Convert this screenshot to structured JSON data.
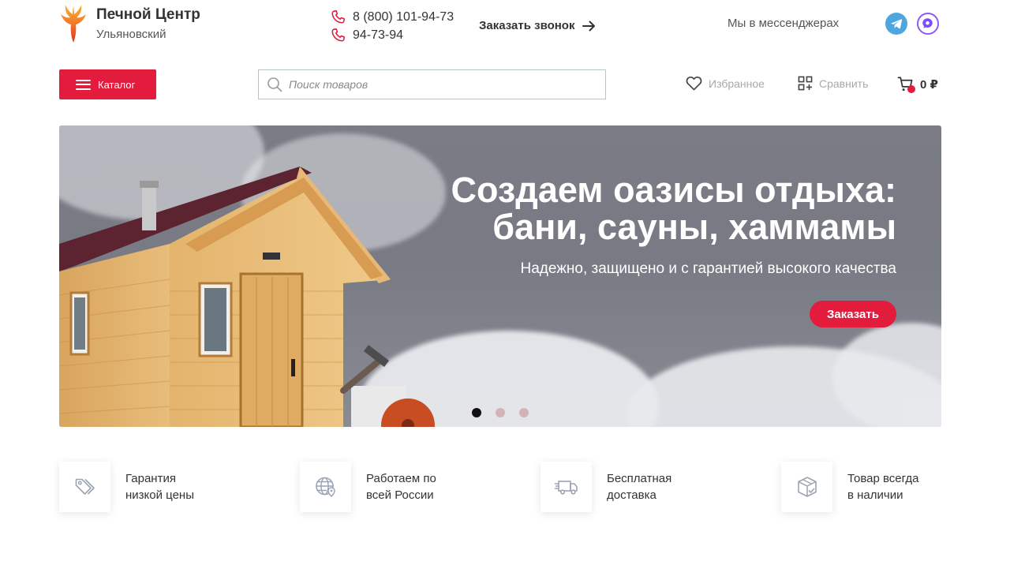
{
  "header": {
    "brand_name": "Печной Центр",
    "brand_sub": "Ульяновский",
    "phones": [
      "8 (800) 101-94-73",
      "94-73-94"
    ],
    "callback_label": "Заказать звонок",
    "messengers_label": "Мы в мессенджерах",
    "messenger_icons": [
      "telegram-icon",
      "max-messenger-icon"
    ]
  },
  "toolbar": {
    "catalog_label": "Каталог",
    "search_placeholder": "Поиск товаров",
    "search_value": "",
    "favorites_label": "Избранное",
    "compare_label": "Сравнить",
    "cart_total": "0 ₽"
  },
  "banner": {
    "title_line1": "Создаем оазисы отдыха:",
    "title_line2": "бани, сауны, хаммамы",
    "subtitle": "Надежно, защищено и с гарантией высокого качества",
    "order_label": "Заказать",
    "slides_count": 3,
    "active_slide": 1
  },
  "features": [
    {
      "line1": "Гарантия",
      "line2": "низкой цены",
      "icon": "price-tag-icon"
    },
    {
      "line1": "Работаем по",
      "line2": "всей России",
      "icon": "globe-location-icon"
    },
    {
      "line1": "Бесплатная",
      "line2": "доставка",
      "icon": "delivery-truck-icon"
    },
    {
      "line1": "Товар всегда",
      "line2": "в наличии",
      "icon": "box-check-icon"
    }
  ],
  "colors": {
    "accent": "#e31b3d",
    "banner_bg": "#7b7c85",
    "telegram": "#4ea6df",
    "max": "#8b5cf6"
  }
}
